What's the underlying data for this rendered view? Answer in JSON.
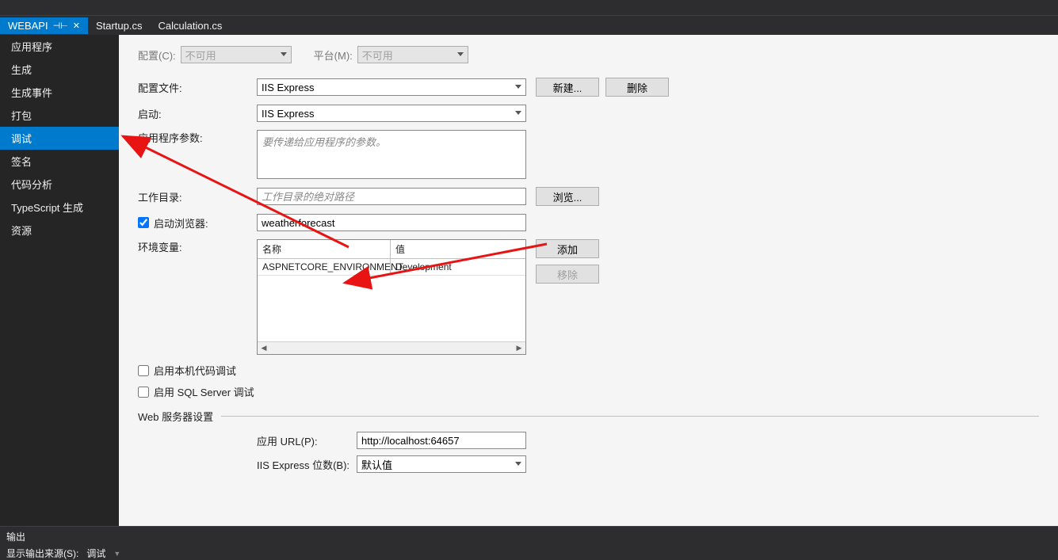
{
  "tabs": {
    "active": "WEBAPI",
    "items": [
      "WEBAPI",
      "Startup.cs",
      "Calculation.cs"
    ]
  },
  "sidebar": {
    "items": [
      "应用程序",
      "生成",
      "生成事件",
      "打包",
      "调试",
      "签名",
      "代码分析",
      "TypeScript 生成",
      "资源"
    ],
    "selected": "调试"
  },
  "header": {
    "config_label": "配置(C):",
    "config_value": "不可用",
    "platform_label": "平台(M):",
    "platform_value": "不可用"
  },
  "form": {
    "profile_label": "配置文件:",
    "profile_value": "IIS Express",
    "new_btn": "新建...",
    "delete_btn": "删除",
    "launch_label": "启动:",
    "launch_value": "IIS Express",
    "appargs_label": "应用程序参数:",
    "appargs_placeholder": "要传递给应用程序的参数。",
    "workdir_label": "工作目录:",
    "workdir_placeholder": "工作目录的绝对路径",
    "browse_btn": "浏览...",
    "launch_browser_label": "启动浏览器:",
    "launch_browser_value": "weatherforecast",
    "envvar_label": "环境变量:",
    "table_header_name": "名称",
    "table_header_value": "值",
    "env_rows": [
      {
        "name": "ASPNETCORE_ENVIRONMENT",
        "value": "Development"
      }
    ],
    "add_btn": "添加",
    "remove_btn": "移除",
    "native_debug_label": "启用本机代码调试",
    "sql_debug_label": "启用 SQL Server 调试",
    "webserver_section": "Web 服务器设置",
    "appurl_label": "应用 URL(P):",
    "appurl_value": "http://localhost:64657",
    "iis_bits_label": "IIS Express 位数(B):",
    "iis_bits_value": "默认值"
  },
  "output": {
    "title": "输出",
    "source_label": "显示输出来源(S):",
    "source_value": "调试"
  }
}
